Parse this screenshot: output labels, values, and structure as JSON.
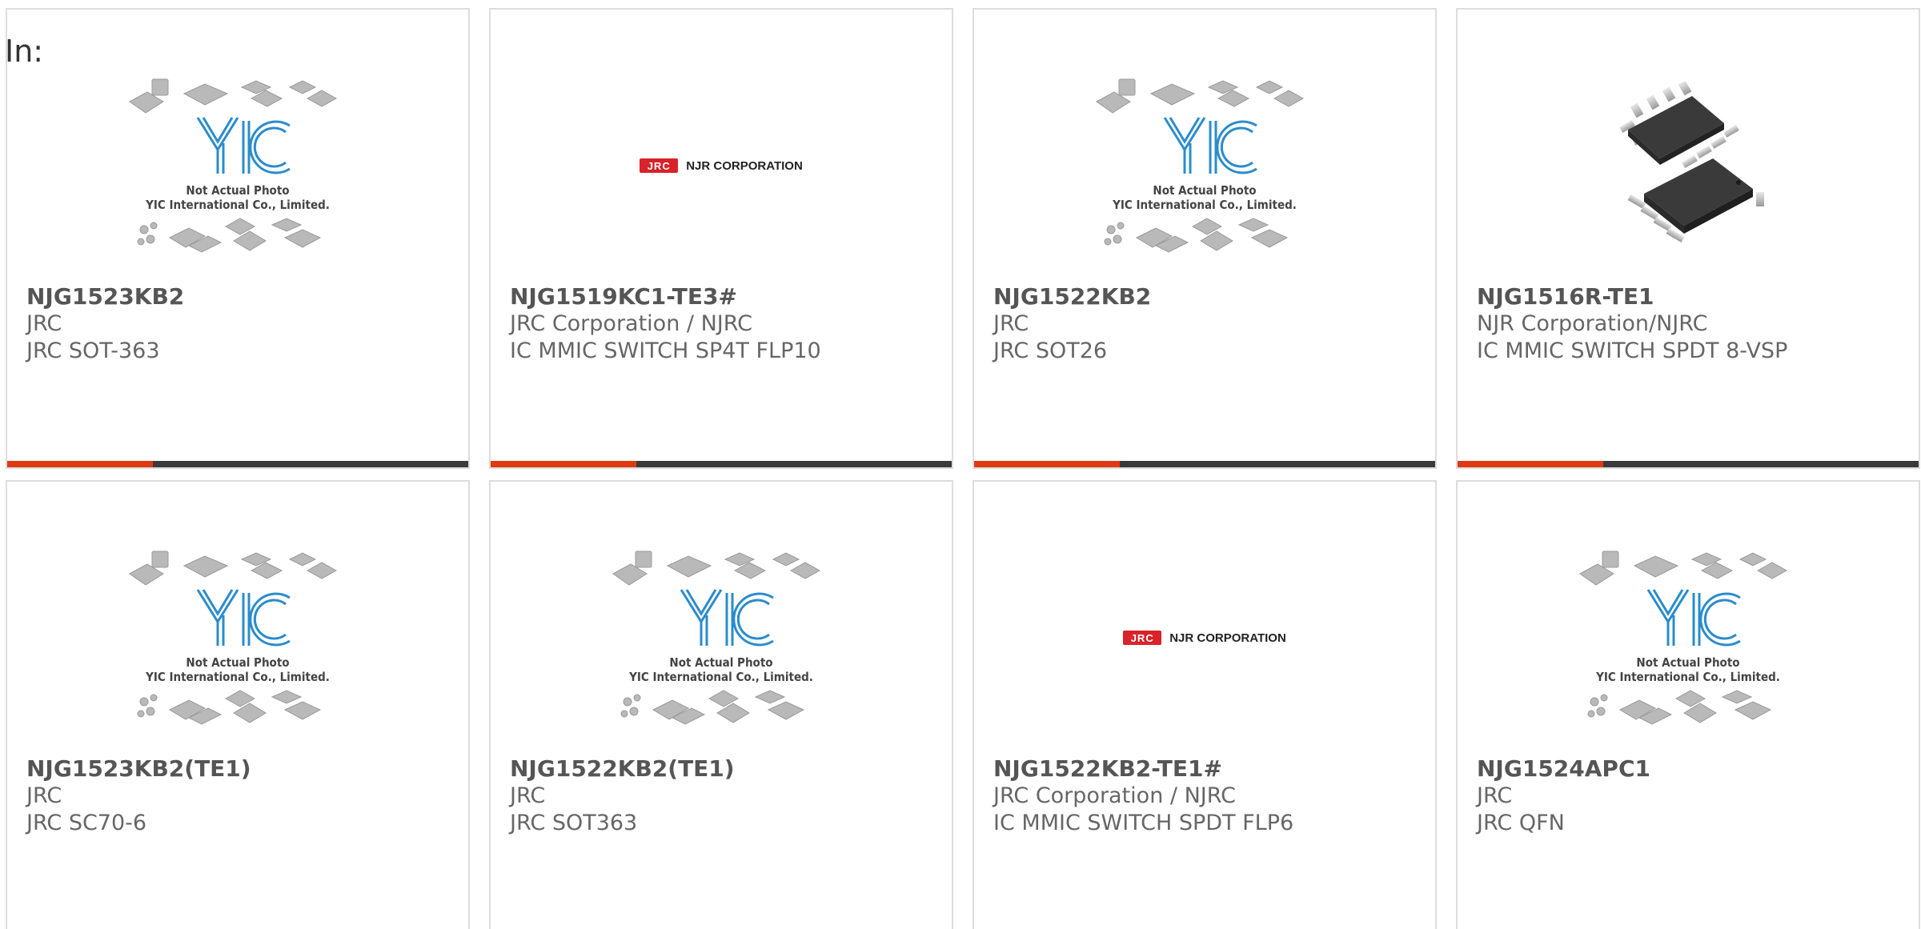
{
  "header": {
    "in_label": "In:"
  },
  "colors": {
    "accent": "#e03a12",
    "bar": "#3a3a3a",
    "yic_blue": "#2a8ccd"
  },
  "placeholder": {
    "line1": "Not Actual Photo",
    "line2": "YIC International Co., Limited."
  },
  "njr_logo": {
    "badge": "JRC",
    "text": "NJR CORPORATION"
  },
  "products": [
    {
      "part": "NJG1523KB2",
      "manufacturer": "JRC",
      "description": "JRC SOT-363",
      "image": "yic-placeholder"
    },
    {
      "part": "NJG1519KC1-TE3#",
      "manufacturer": "JRC Corporation / NJRC",
      "description": "IC MMIC SWITCH SP4T FLP10",
      "image": "njr-logo"
    },
    {
      "part": "NJG1522KB2",
      "manufacturer": "JRC",
      "description": "JRC SOT26",
      "image": "yic-placeholder"
    },
    {
      "part": "NJG1516R-TE1",
      "manufacturer": "NJR Corporation/NJRC",
      "description": "IC MMIC SWITCH SPDT 8-VSP",
      "image": "chip-photo"
    },
    {
      "part": "NJG1523KB2(TE1)",
      "manufacturer": "JRC",
      "description": "JRC SC70-6",
      "image": "yic-placeholder"
    },
    {
      "part": "NJG1522KB2(TE1)",
      "manufacturer": "JRC",
      "description": "JRC SOT363",
      "image": "yic-placeholder"
    },
    {
      "part": "NJG1522KB2-TE1#",
      "manufacturer": "JRC Corporation / NJRC",
      "description": "IC MMIC SWITCH SPDT FLP6",
      "image": "njr-logo"
    },
    {
      "part": "NJG1524APC1",
      "manufacturer": "JRC",
      "description": "JRC QFN",
      "image": "yic-placeholder"
    }
  ]
}
